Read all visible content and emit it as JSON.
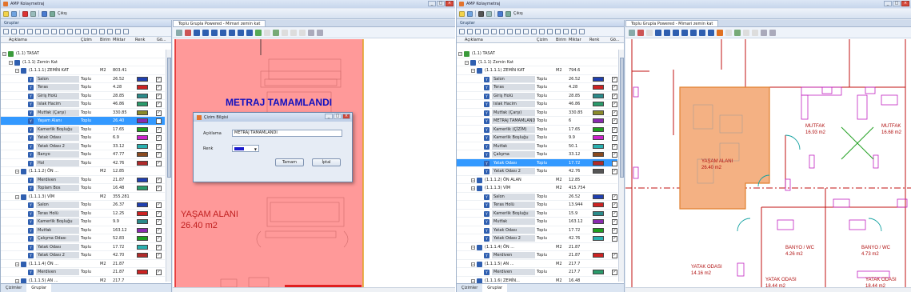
{
  "app": {
    "title": "AMP Kolaymetraj",
    "toolbar_text": "Çıkış"
  },
  "colors": {
    "accent": "#3399ff",
    "pink_fill": "#ff9999",
    "orange_fill": "#f4b183"
  },
  "left_panel": {
    "title": "Gruplar",
    "columns": {
      "desc": "Açıklama",
      "type": "Çizim",
      "unit": "Birim",
      "qty": "Miktar",
      "color": "Renk",
      "visible": "Gö..."
    },
    "tabs": [
      "Çizimler",
      "Gruplar"
    ]
  },
  "w1_rows": [
    {
      "kind": "root",
      "level": 0,
      "label": "(1.1) TASAT"
    },
    {
      "kind": "group",
      "level": 1,
      "label": "(1.1.1) Zemin Kat"
    },
    {
      "kind": "group",
      "level": 2,
      "label": "(1.1.1.1) ZEMİN KAT",
      "unit": "M2",
      "qty": "803.41"
    },
    {
      "kind": "leaf",
      "label": "Salon",
      "type": "Toplu",
      "qty": "26.52",
      "color": "#1f3fb0",
      "cb": "✓"
    },
    {
      "kind": "leaf",
      "label": "Teras",
      "type": "Toplu",
      "qty": "4.28",
      "color": "#cc2222",
      "cb": "✓"
    },
    {
      "kind": "leaf",
      "label": "Giriş Holü",
      "type": "Toplu",
      "qty": "28.85",
      "color": "#2a8a8a",
      "cb": "✓"
    },
    {
      "kind": "leaf",
      "label": "Islak Hacim",
      "type": "Toplu",
      "qty": "46.86",
      "color": "#2a9a6a",
      "cb": "✓"
    },
    {
      "kind": "leaf",
      "label": "Mutfak (Çarşı)",
      "type": "Toplu",
      "qty": "330.85",
      "color": "#8a8a2a",
      "cb": "✓"
    },
    {
      "kind": "leaf",
      "label": "Yaşam Alanı",
      "type": "Toplu",
      "qty": "26.40",
      "color": "#8a2ab0",
      "cb": "",
      "sel": true
    },
    {
      "kind": "leaf",
      "label": "Kamerlik Boşluğu",
      "type": "Toplu",
      "qty": "17.65",
      "color": "#1f9f1f",
      "cb": "✓"
    },
    {
      "kind": "leaf",
      "label": "Yatak Odası",
      "type": "Toplu",
      "qty": "6.9",
      "color": "#cc22cc",
      "cb": "✓"
    },
    {
      "kind": "leaf",
      "label": "Yatak Odası 2",
      "type": "Toplu",
      "qty": "33.12",
      "color": "#2ab0b0",
      "cb": "✓"
    },
    {
      "kind": "leaf",
      "label": "Banyo",
      "type": "Toplu",
      "qty": "47.77",
      "color": "#8a4a1f",
      "cb": "✓"
    },
    {
      "kind": "leaf",
      "label": "Hol",
      "type": "Toplu",
      "qty": "42.76",
      "color": "#b02a2a",
      "cb": "✓"
    },
    {
      "kind": "group",
      "level": 2,
      "label": "(1.1.1.2) ÖN ...",
      "unit": "M2",
      "qty": "12.85"
    },
    {
      "kind": "leaf",
      "label": "Merdiven",
      "type": "Toplu",
      "qty": "21.87",
      "color": "#1f3fb0",
      "cb": "✓"
    },
    {
      "kind": "leaf",
      "label": "Toplam Bos",
      "type": "Toplu",
      "qty": "16.48",
      "color": "#2a9a6a",
      "cb": "✓"
    },
    {
      "kind": "group",
      "level": 2,
      "label": "(1.1.1.3) VİM",
      "unit": "M2",
      "qty": "355.281"
    },
    {
      "kind": "leaf",
      "label": "Salon",
      "type": "Toplu",
      "qty": "26.37",
      "color": "#1f3fb0",
      "cb": "✓"
    },
    {
      "kind": "leaf",
      "label": "Teras Holü",
      "type": "Toplu",
      "qty": "12.25",
      "color": "#cc2222",
      "cb": "✓"
    },
    {
      "kind": "leaf",
      "label": "Kamerlik Boşluğu",
      "type": "Toplu",
      "qty": "9.9",
      "color": "#2a8a8a",
      "cb": "✓"
    },
    {
      "kind": "leaf",
      "label": "Mutfak",
      "type": "Toplu",
      "qty": "163.12",
      "color": "#8a2ab0",
      "cb": "✓"
    },
    {
      "kind": "leaf",
      "label": "Çalışma Odası",
      "type": "Toplu",
      "qty": "52.83",
      "color": "#1f9f1f",
      "cb": "✓"
    },
    {
      "kind": "leaf",
      "label": "Yatak Odası",
      "type": "Toplu",
      "qty": "17.72",
      "color": "#2ab0b0",
      "cb": "✓"
    },
    {
      "kind": "leaf",
      "label": "Yatak Odası 2",
      "type": "Toplu",
      "qty": "42.70",
      "color": "#b02a2a",
      "cb": "✓"
    },
    {
      "kind": "group",
      "level": 2,
      "label": "(1.1.1.4) ÖN ...",
      "unit": "M2",
      "qty": "21.87"
    },
    {
      "kind": "leaf",
      "label": "Merdiven",
      "type": "Toplu",
      "qty": "21.87",
      "color": "#cc2222",
      "cb": "✓"
    },
    {
      "kind": "group",
      "level": 2,
      "label": "(1.1.1.5) AN ...",
      "unit": "M2",
      "qty": "217.7"
    },
    {
      "kind": "leaf",
      "label": "Merdiven",
      "type": "Toplu",
      "qty": "217.7",
      "color": "#2a9a6a",
      "cb": "✓"
    },
    {
      "kind": "group",
      "level": 2,
      "label": "(1.1.1.6) ZEMİN...",
      "unit": "M2",
      "qty": "16.48"
    }
  ],
  "w2_rows": [
    {
      "kind": "root",
      "level": 0,
      "label": "(1.1) TASAT"
    },
    {
      "kind": "group",
      "level": 1,
      "label": "(1.1.1) Zemin Kat"
    },
    {
      "kind": "group",
      "level": 2,
      "label": "(1.1.1.1) ZEMİN KAT",
      "unit": "M2",
      "qty": "794.6"
    },
    {
      "kind": "leaf",
      "label": "Salon",
      "type": "Toplu",
      "qty": "26.52",
      "color": "#1f3fb0",
      "cb": "✓"
    },
    {
      "kind": "leaf",
      "label": "Teras",
      "type": "Toplu",
      "qty": "4.28",
      "color": "#cc2222",
      "cb": "✓"
    },
    {
      "kind": "leaf",
      "label": "Giriş Holü",
      "type": "Toplu",
      "qty": "28.85",
      "color": "#2a8a8a",
      "cb": "✓"
    },
    {
      "kind": "leaf",
      "label": "Islak Hacim",
      "type": "Toplu",
      "qty": "46.86",
      "color": "#2a9a6a",
      "cb": "✓"
    },
    {
      "kind": "leaf",
      "label": "Mutfak (Çarşı)",
      "type": "Toplu",
      "qty": "330.85",
      "color": "#8a8a2a",
      "cb": "✓"
    },
    {
      "kind": "leaf",
      "label": "METRAJ TAMAMLANDI",
      "type": "Toplu",
      "qty": "6",
      "color": "#8a2ab0",
      "cb": "✓"
    },
    {
      "kind": "leaf",
      "label": "Kamerlik (ÇİZİM)",
      "type": "Toplu",
      "qty": "17.65",
      "color": "#1f9f1f",
      "cb": "✓"
    },
    {
      "kind": "leaf",
      "label": "Kamerlik Boşluğu",
      "type": "Toplu",
      "qty": "9.9",
      "color": "#cc22cc",
      "cb": "✓"
    },
    {
      "kind": "leaf",
      "label": "Mutfak",
      "type": "Toplu",
      "qty": "50.1",
      "color": "#2ab0b0",
      "cb": "✓"
    },
    {
      "kind": "leaf",
      "label": "Çalışma",
      "type": "Toplu",
      "qty": "33.12",
      "color": "#8a4a1f",
      "cb": "✓"
    },
    {
      "kind": "leaf",
      "label": "Yatak Odası",
      "type": "Toplu",
      "qty": "17.72",
      "color": "#b02a2a",
      "cb": "",
      "sel": true
    },
    {
      "kind": "leaf",
      "label": "Yatak Odası 2",
      "type": "Toplu",
      "qty": "42.76",
      "color": "#555555",
      "cb": "✓"
    },
    {
      "kind": "group",
      "level": 2,
      "label": "(1.1.1.2) ÖN ALAN",
      "unit": "M2",
      "qty": "12.85"
    },
    {
      "kind": "group",
      "level": 2,
      "label": "(1.1.1.3) VİM",
      "unit": "M2",
      "qty": "415.754"
    },
    {
      "kind": "leaf",
      "label": "Salon",
      "type": "Toplu",
      "qty": "26.52",
      "color": "#1f3fb0",
      "cb": "✓"
    },
    {
      "kind": "leaf",
      "label": "Teras Holü",
      "type": "Toplu",
      "qty": "13.944",
      "color": "#cc2222",
      "cb": "✓"
    },
    {
      "kind": "leaf",
      "label": "Kamerlik Boşluğu",
      "type": "Toplu",
      "qty": "15.9",
      "color": "#2a8a8a",
      "cb": "✓"
    },
    {
      "kind": "leaf",
      "label": "Mutfak",
      "type": "Toplu",
      "qty": "163.12",
      "color": "#8a2ab0",
      "cb": "✓"
    },
    {
      "kind": "leaf",
      "label": "Yatak Odası",
      "type": "Toplu",
      "qty": "17.72",
      "color": "#1f9f1f",
      "cb": "✓"
    },
    {
      "kind": "leaf",
      "label": "Yatak Odası 2",
      "type": "Toplu",
      "qty": "42.76",
      "color": "#2ab0b0",
      "cb": "✓"
    },
    {
      "kind": "group",
      "level": 2,
      "label": "(1.1.1.4) ÖN ...",
      "unit": "M2",
      "qty": "21.87"
    },
    {
      "kind": "leaf",
      "label": "Merdiven",
      "type": "Toplu",
      "qty": "21.87",
      "color": "#cc2222",
      "cb": "✓"
    },
    {
      "kind": "group",
      "level": 2,
      "label": "(1.1.1.5) AN ...",
      "unit": "M2",
      "qty": "217.7"
    },
    {
      "kind": "leaf",
      "label": "Merdiven",
      "type": "Toplu",
      "qty": "217.7",
      "color": "#2a9a6a",
      "cb": "✓"
    },
    {
      "kind": "group",
      "level": 2,
      "label": "(1.1.1.6) ZEMİN...",
      "unit": "M2",
      "qty": "16.48"
    }
  ],
  "drawing": {
    "tab_label": "Toplu Grupla Powered - Mimari zemin kat",
    "metraj_label": "METRAJ TAMAMLANDI",
    "yasam_label": "YAŞAM ALANI",
    "yasam_area": "26.40 m2",
    "mutfak_label": "MUTFAK",
    "mutfak_area": "16.93 m2",
    "mutfak2_area": "16.68 m2",
    "yatak_label": "YATAK ODASI",
    "yatak1_area": "14.16 m2",
    "yatak2_area": "18.44 m2",
    "banyo_label": "BANYO / WC",
    "banyo1_area": "4.26 m2",
    "banyo2_area": "4.73 m2"
  },
  "dialog": {
    "title": "Çizim Bilgisi",
    "desc_label": "Açıklama",
    "desc_value": "METRAJ TAMAMLANDI",
    "color_label": "Renk",
    "color_value": "Mavi",
    "ok": "Tamam",
    "cancel": "İptal"
  }
}
